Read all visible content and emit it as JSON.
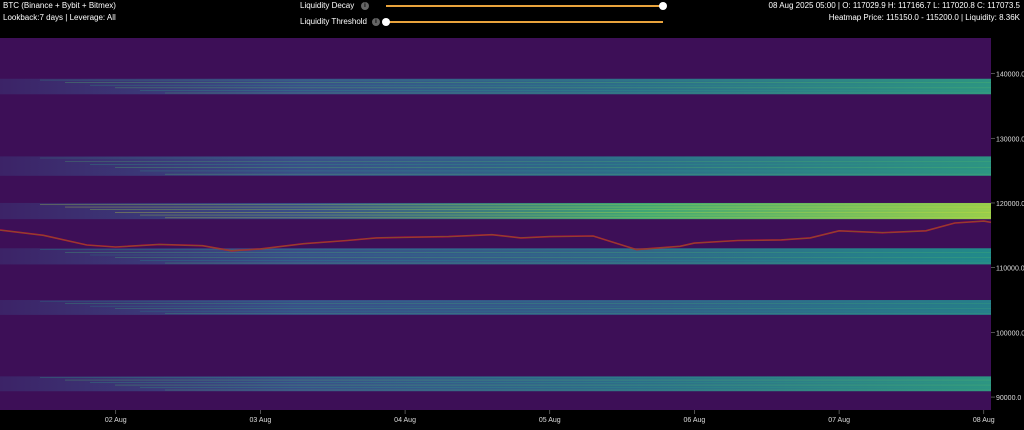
{
  "header": {
    "title": "BTC (Binance + Bybit + Bitmex)",
    "subtitle": "Lookback:7 days | Leverage: All",
    "ohlc": "08 Aug 2025 05:00 | O: 117029.9 H: 117166.7 L: 117020.8 C: 117073.5",
    "heatmap_info": "Heatmap Price: 115150.0 - 115200.0 | Liquidity: 8.36K"
  },
  "controls": {
    "decay_label": "Liquidity Decay",
    "threshold_label": "Liquidity Threshold",
    "decay_value": 1.0,
    "threshold_value": 0.0,
    "info_icon": "info-icon"
  },
  "chart_data": {
    "type": "heatmap",
    "title": "",
    "xlabel": "",
    "ylabel": "",
    "x_ticks": [
      "02 Aug",
      "03 Aug",
      "04 Aug",
      "05 Aug",
      "06 Aug",
      "07 Aug",
      "08 Aug"
    ],
    "y_ticks": [
      "90000.0",
      "100000.0",
      "110000.0",
      "120000.0",
      "130000.0",
      "140000.0"
    ],
    "ylim": [
      88000,
      145500
    ],
    "xlim_days": [
      0.2,
      7.05
    ],
    "liquidity_bands": [
      {
        "price_low": 136800,
        "price_high": 139200,
        "intensity": 0.55
      },
      {
        "price_low": 124200,
        "price_high": 127200,
        "intensity": 0.55
      },
      {
        "price_low": 117500,
        "price_high": 120000,
        "intensity": 0.9
      },
      {
        "price_low": 110500,
        "price_high": 113000,
        "intensity": 0.5
      },
      {
        "price_low": 102700,
        "price_high": 105000,
        "intensity": 0.45
      },
      {
        "price_low": 90900,
        "price_high": 93200,
        "intensity": 0.55
      }
    ],
    "price_series": {
      "name": "BTC",
      "x": [
        0.2,
        0.5,
        0.8,
        1.0,
        1.3,
        1.6,
        1.8,
        2.0,
        2.3,
        2.6,
        2.8,
        3.0,
        3.3,
        3.6,
        3.8,
        4.0,
        4.3,
        4.6,
        4.9,
        5.0,
        5.3,
        5.6,
        5.8,
        6.0,
        6.3,
        6.6,
        6.8,
        7.0,
        7.05
      ],
      "y": [
        115800,
        115000,
        113500,
        113200,
        113600,
        113400,
        112600,
        112900,
        113700,
        114200,
        114600,
        114700,
        114800,
        115100,
        114600,
        114800,
        114900,
        112800,
        113300,
        113800,
        114200,
        114300,
        114600,
        115700,
        115400,
        115700,
        116900,
        117200,
        117000
      ]
    }
  }
}
